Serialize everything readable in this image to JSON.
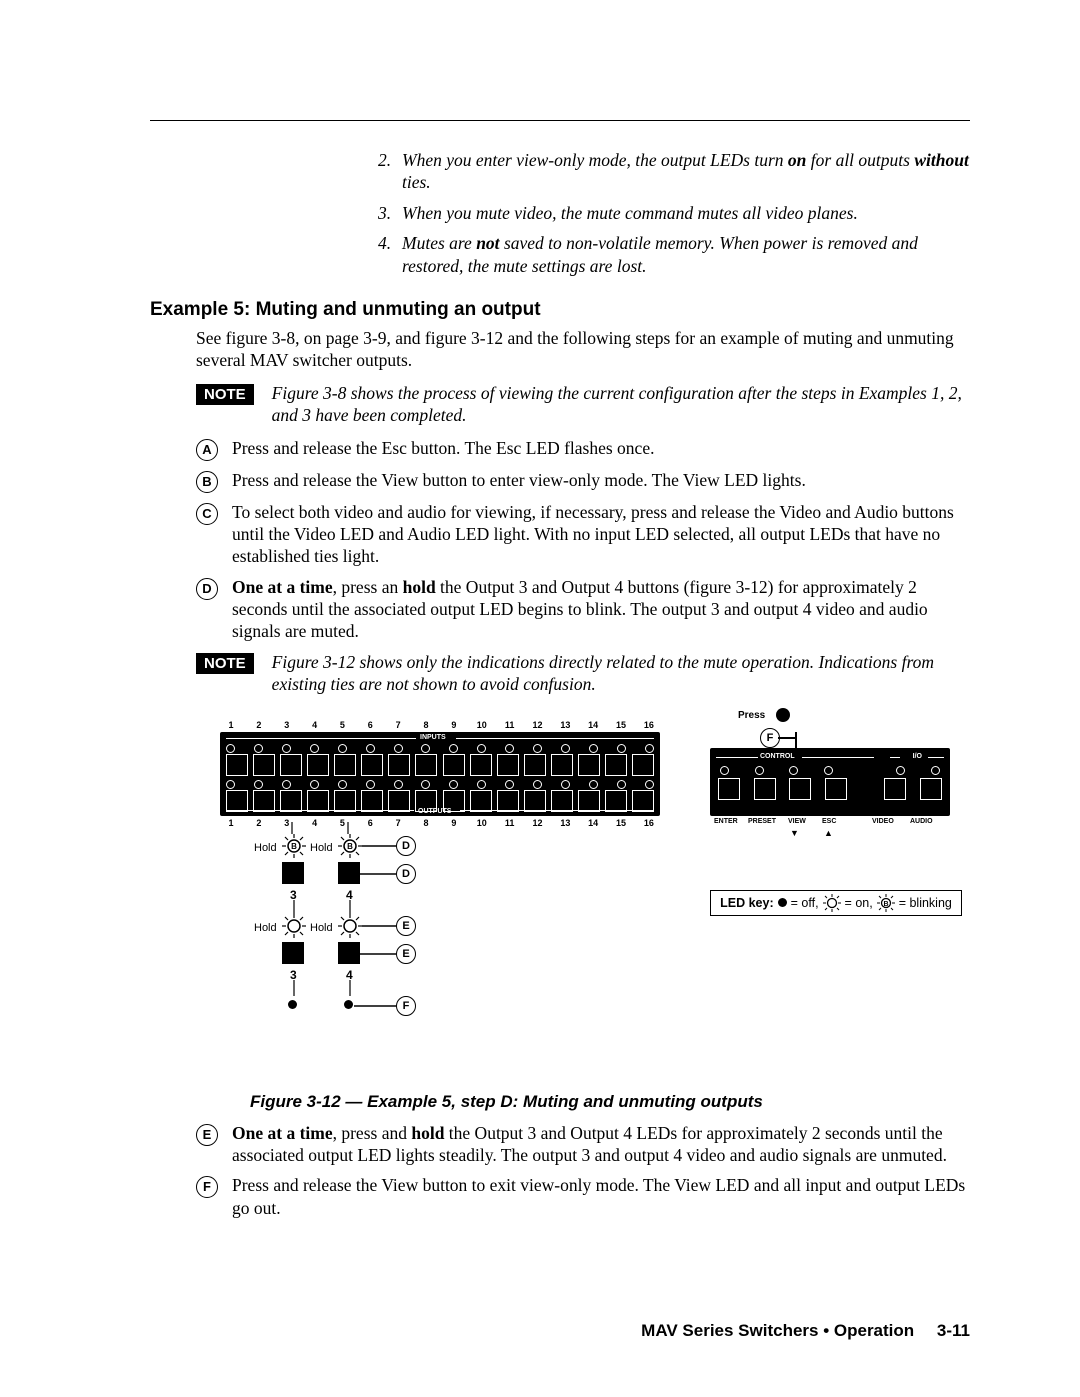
{
  "notes_top": [
    {
      "num": "2.",
      "text_a": "When you enter view-only mode, the output LEDs turn ",
      "bold": "on",
      "text_b": " for all outputs ",
      "bold2": "without",
      "text_c": " ties."
    },
    {
      "num": "3.",
      "text_a": "When you mute video, the mute command mutes all video planes."
    },
    {
      "num": "4.",
      "text_a": "Mutes are ",
      "bold": "not",
      "text_b": " saved to non-volatile memory.  When power is removed and restored, the mute settings are lost."
    }
  ],
  "section_title": "Example 5:  Muting and unmuting an output",
  "intro": "See figure 3-8, on page 3-9, and figure 3-12 and the following steps for an example of muting and unmuting several MAV switcher outputs.",
  "note1_label": "NOTE",
  "note1_text": "Figure 3-8 shows the process of viewing the current configuration after the steps in Examples 1, 2, and 3 have been completed.",
  "steps_top": [
    {
      "l": "A",
      "text": "Press and release the Esc button.  The Esc LED flashes once."
    },
    {
      "l": "B",
      "text": "Press and release the View button to enter view-only mode.  The View LED lights."
    },
    {
      "l": "C",
      "text": "To select both video and audio for viewing, if necessary, press and release the Video and Audio buttons until the Video LED and Audio LED light.  With no input LED selected, all output LEDs that have no established ties light."
    }
  ],
  "step_d": {
    "l": "D",
    "lead": "One at a time",
    "mid": ", press an ",
    "bold": "hold",
    "rest": " the Output 3 and Output 4 buttons (figure 3-12) for approximately 2 seconds until the associated output LED begins to blink.  The output 3 and output 4 video and audio signals are muted."
  },
  "note2_label": "NOTE",
  "note2_text": "Figure 3-12 shows only the indications directly related to the mute operation.  Indications from existing ties are not shown to avoid confusion.",
  "figure": {
    "press": "Press",
    "view": "VIEW",
    "inputs": "INPUTS",
    "outputs": "OUTPUTS",
    "control": "CONTROL",
    "io": "I/O",
    "enter": "ENTER",
    "preset": "PRESET",
    "viewb": "VIEW",
    "esc": "ESC",
    "video": "VIDEO",
    "audio": "AUDIO",
    "hold": "Hold",
    "numbers": [
      "1",
      "2",
      "3",
      "4",
      "5",
      "6",
      "7",
      "8",
      "9",
      "10",
      "11",
      "12",
      "13",
      "14",
      "15",
      "16"
    ],
    "ledkey_lead": "LED key:",
    "off": "= off,",
    "on": "= on,",
    "blink": "= blinking"
  },
  "figcaption": "Figure 3-12 — Example 5, step D:  Muting and unmuting outputs",
  "step_e": {
    "l": "E",
    "lead": "One at a time",
    "mid": ", press and ",
    "bold": "hold",
    "rest": " the Output 3 and Output 4 LEDs for approximately 2 seconds until the associated output LED lights steadily.  The output 3 and output 4 video and audio signals are unmuted."
  },
  "step_f": {
    "l": "F",
    "text": "Press and release the View button to exit view-only mode.  The View LED and all input and output LEDs go out."
  },
  "footer": {
    "title": "MAV Series Switchers • Operation",
    "page": "3-11"
  }
}
